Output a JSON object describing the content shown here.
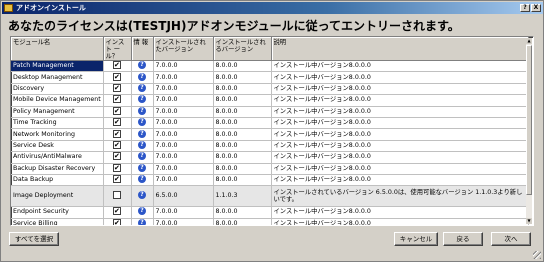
{
  "window": {
    "title": "アドオンインストール",
    "help_button": "?",
    "close_button": "X"
  },
  "heading": "あなたのライセンスは(TESTJH)アドオンモジュールに従ってエントリーされます。",
  "table": {
    "columns": {
      "module": "モジュール名",
      "install": "インスト ール？",
      "info": "情 報",
      "installed_version": "インストールされたバージョン",
      "installable_version": "インストールされるバージョン",
      "description": "説明"
    },
    "rows": [
      {
        "name": "Patch Management",
        "install": true,
        "installed": "7.0.0.0",
        "target": "8.0.0.0",
        "desc": "インストール中バージョン8.0.0.0",
        "selected": true
      },
      {
        "name": "Desktop Management",
        "install": true,
        "installed": "7.0.0.0",
        "target": "8.0.0.0",
        "desc": "インストール中バージョン8.0.0.0"
      },
      {
        "name": "Discovery",
        "install": true,
        "installed": "7.0.0.0",
        "target": "8.0.0.0",
        "desc": "インストール中バージョン8.0.0.0"
      },
      {
        "name": "Mobile Device Management",
        "install": true,
        "installed": "7.0.0.0",
        "target": "8.0.0.0",
        "desc": "インストール中バージョン8.0.0.0"
      },
      {
        "name": "Policy Management",
        "install": true,
        "installed": "7.0.0.0",
        "target": "8.0.0.0",
        "desc": "インストール中バージョン8.0.0.0"
      },
      {
        "name": "Time Tracking",
        "install": true,
        "installed": "7.0.0.0",
        "target": "8.0.0.0",
        "desc": "インストール中バージョン8.0.0.0"
      },
      {
        "name": "Network Monitoring",
        "install": true,
        "installed": "7.0.0.0",
        "target": "8.0.0.0",
        "desc": "インストール中バージョン8.0.0.0"
      },
      {
        "name": "Service Desk",
        "install": true,
        "installed": "7.0.0.0",
        "target": "8.0.0.0",
        "desc": "インストール中バージョン8.0.0.0"
      },
      {
        "name": "Antivirus/AntiMalware",
        "install": true,
        "installed": "7.0.0.0",
        "target": "8.0.0.0",
        "desc": "インストール中バージョン8.0.0.0"
      },
      {
        "name": "Backup Disaster Recovery",
        "install": true,
        "installed": "7.0.0.0",
        "target": "8.0.0.0",
        "desc": "インストール中バージョン8.0.0.0"
      },
      {
        "name": "Data Backup",
        "install": true,
        "installed": "7.0.0.0",
        "target": "8.0.0.0",
        "desc": "インストール中バージョン8.0.0.0"
      },
      {
        "name": "Image Deployment",
        "install": false,
        "installed": "6.5.0.0",
        "target": "1.1.0.3",
        "desc": "インストールされているバージョン 6.5.0.0は、使用可能なバージョン 1.1.0.3より新しいです。",
        "disabled": true
      },
      {
        "name": "Endpoint Security",
        "install": true,
        "installed": "7.0.0.0",
        "target": "8.0.0.0",
        "desc": "インストール中バージョン8.0.0.0"
      },
      {
        "name": "Service Billing",
        "install": true,
        "installed": "7.0.0.0",
        "target": "8.0.0.0",
        "desc": "インストール中バージョン8.0.0.0"
      }
    ]
  },
  "buttons": {
    "select_all": "すべてを選択",
    "cancel": "キャンセル",
    "back": "戻る",
    "next": "次へ"
  },
  "icons": {
    "info": "info-icon",
    "checkbox": "checkbox"
  },
  "colors": {
    "titlebar": "#0a246a",
    "selection": "#0a246a",
    "info_icon": "#2c56c8"
  }
}
